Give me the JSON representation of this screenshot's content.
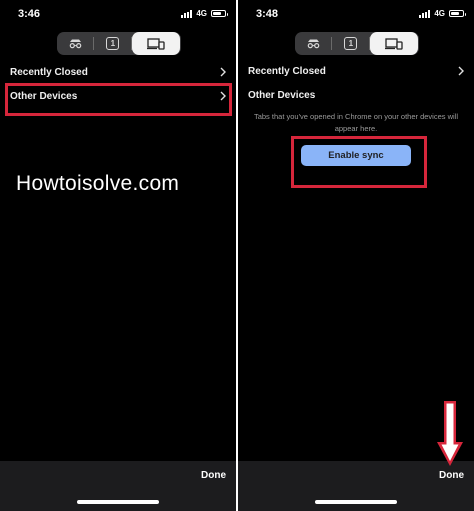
{
  "left_screen": {
    "status_time": "3:46",
    "network": "4G",
    "tabs": {
      "incognito_icon": "incognito-icon",
      "tab_count": "1",
      "devices_icon": "devices-icon"
    },
    "rows": [
      {
        "label": "Recently Closed"
      },
      {
        "label": "Other Devices"
      }
    ],
    "watermark": "Howtoisolve.com",
    "done_label": "Done"
  },
  "right_screen": {
    "status_time": "3:48",
    "network": "4G",
    "tabs": {
      "incognito_icon": "incognito-icon",
      "tab_count": "1",
      "devices_icon": "devices-icon"
    },
    "rows": [
      {
        "label": "Recently Closed"
      },
      {
        "label": "Other Devices"
      }
    ],
    "info_text": "Tabs that you've opened in Chrome on your other devices will appear here.",
    "enable_sync_label": "Enable sync",
    "done_label": "Done"
  },
  "colors": {
    "highlight": "#d6263b",
    "sync_button": "#8ab4f8",
    "background": "#000000",
    "toolbar": "#1c1c1e"
  }
}
